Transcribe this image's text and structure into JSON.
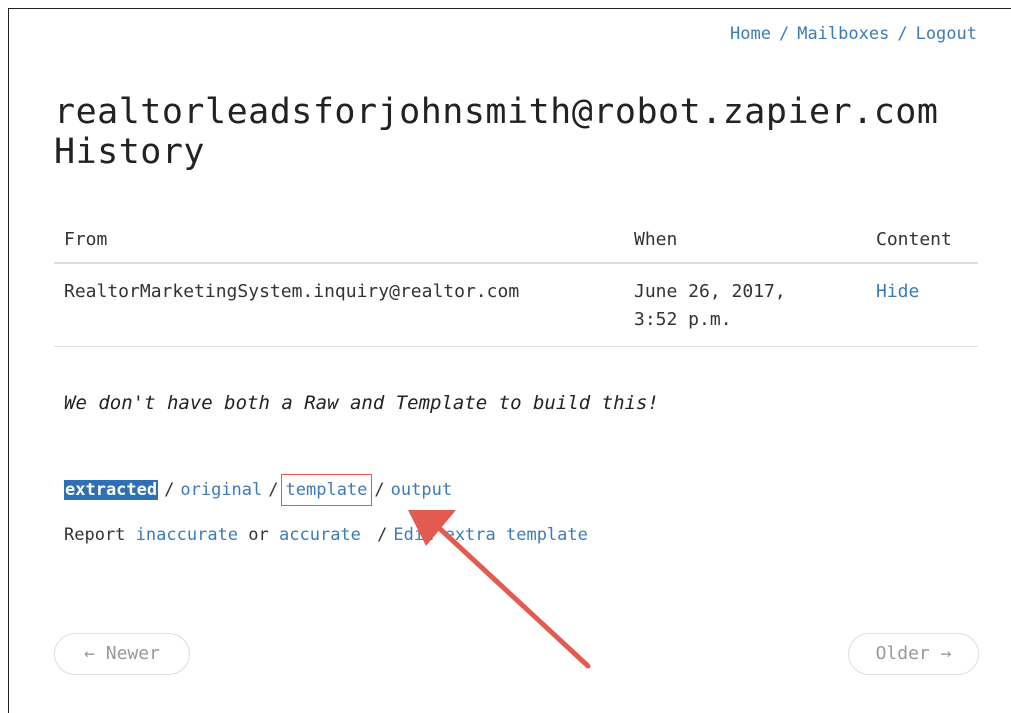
{
  "nav": {
    "home": "Home",
    "mailboxes": "Mailboxes",
    "logout": "Logout",
    "separator": "/"
  },
  "page": {
    "title_line1": "realtorleadsforjohnsmith@robot.zapier.com",
    "title_line2": "History"
  },
  "table": {
    "headers": {
      "from": "From",
      "when": "When",
      "content": "Content"
    },
    "rows": [
      {
        "from": "RealtorMarketingSystem.inquiry@realtor.com",
        "when_line1": "June 26, 2017,",
        "when_line2": "3:52 p.m.",
        "content": "Hide"
      }
    ]
  },
  "notice": "We don't have both a Raw and Template to build this!",
  "views": {
    "extracted": "extracted",
    "original": "original",
    "template": "template",
    "output": "output",
    "separator": "/"
  },
  "report": {
    "prefix": "Report",
    "inaccurate": "inaccurate",
    "or": "or",
    "accurate": "accurate",
    "separator": "/",
    "edit_extra_template": "Edit extra template"
  },
  "pager": {
    "newer": "← Newer",
    "older": "Older →"
  },
  "colors": {
    "link": "#3d7ab8",
    "highlight": "#2f6fb5",
    "annotation": "#e35a50"
  }
}
